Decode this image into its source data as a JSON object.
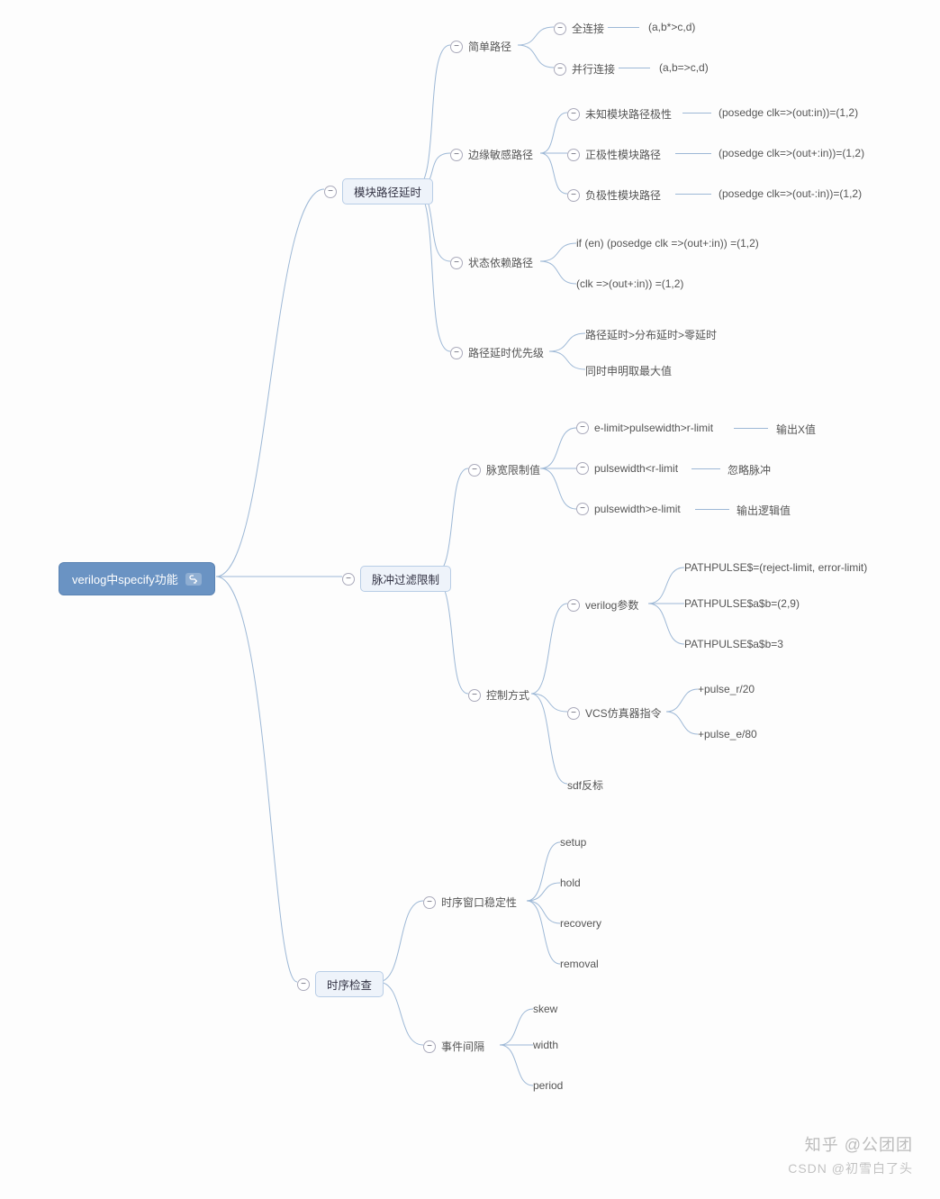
{
  "root": {
    "label": "verilog中specify功能"
  },
  "b1": {
    "label": "模块路径延时",
    "c1": {
      "label": "简单路径",
      "l1": {
        "label": "全连接",
        "detail": "(a,b*>c,d)"
      },
      "l2": {
        "label": "并行连接",
        "detail": "(a,b=>c,d)"
      }
    },
    "c2": {
      "label": "边缘敏感路径",
      "l1": {
        "label": "未知模块路径极性",
        "detail": "(posedge clk=>(out:in))=(1,2)"
      },
      "l2": {
        "label": "正极性模块路径",
        "detail": "(posedge clk=>(out+:in))=(1,2)"
      },
      "l3": {
        "label": "负极性模块路径",
        "detail": "(posedge clk=>(out-:in))=(1,2)"
      }
    },
    "c3": {
      "label": "状态依赖路径",
      "l1": "if (en)   (posedge clk =>(out+:in))  =(1,2)",
      "l2": "(clk =>(out+:in))  =(1,2)"
    },
    "c4": {
      "label": "路径延时优先级",
      "l1": "路径延时>分布延时>零延时",
      "l2": "同时申明取最大值"
    }
  },
  "b2": {
    "label": "脉冲过滤限制",
    "c1": {
      "label": "脉宽限制值",
      "l1": {
        "label": "e-limit>pulsewidth>r-limit",
        "detail": "输出X值"
      },
      "l2": {
        "label": "pulsewidth<r-limit",
        "detail": "忽略脉冲"
      },
      "l3": {
        "label": "pulsewidth>e-limit",
        "detail": "输出逻辑值"
      }
    },
    "c2": {
      "label": "控制方式",
      "d1": {
        "label": "verilog参数",
        "l1": "PATHPULSE$=(reject-limit, error-limit)",
        "l2": "PATHPULSE$a$b=(2,9)",
        "l3": "PATHPULSE$a$b=3"
      },
      "d2": {
        "label": "VCS仿真器指令",
        "l1": "+pulse_r/20",
        "l2": "+pulse_e/80"
      },
      "d3": {
        "label": "sdf反标"
      }
    }
  },
  "b3": {
    "label": "时序检查",
    "c1": {
      "label": "时序窗口稳定性",
      "l1": "setup",
      "l2": "hold",
      "l3": "recovery",
      "l4": "removal"
    },
    "c2": {
      "label": "事件间隔",
      "l1": "skew",
      "l2": "width",
      "l3": "period"
    }
  },
  "watermarks": {
    "zhihu": "知乎 @公团团",
    "csdn": "CSDN @初雪白了头"
  }
}
